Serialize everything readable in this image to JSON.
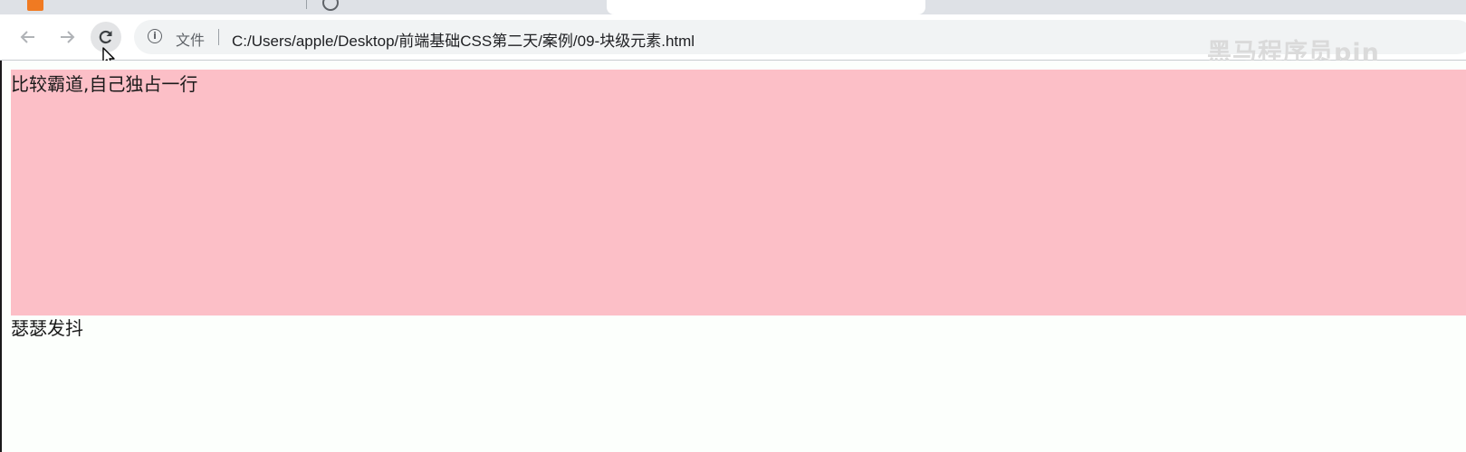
{
  "browser": {
    "tabs": [
      {
        "label": "",
        "active": false,
        "favicon": "orange-square-icon"
      },
      {
        "label": "",
        "active": false,
        "favicon": "globe-icon"
      },
      {
        "label": "",
        "active": true,
        "favicon": "none"
      },
      {
        "label": "",
        "active": false,
        "favicon": "none"
      }
    ],
    "toolbar": {
      "back_icon": "arrow-left-icon",
      "forward_icon": "arrow-right-icon",
      "reload_icon": "reload-icon",
      "info_icon_glyph": "i",
      "file_chip": "文件",
      "url": "C:/Users/apple/Desktop/前端基础CSS第二天/案例/09-块级元素.html"
    },
    "watermark": "黑马程序员pin"
  },
  "page": {
    "block_text": "比较霸道,自己独占一行",
    "block_background": "#fcbfc7",
    "second_text": "瑟瑟发抖"
  }
}
